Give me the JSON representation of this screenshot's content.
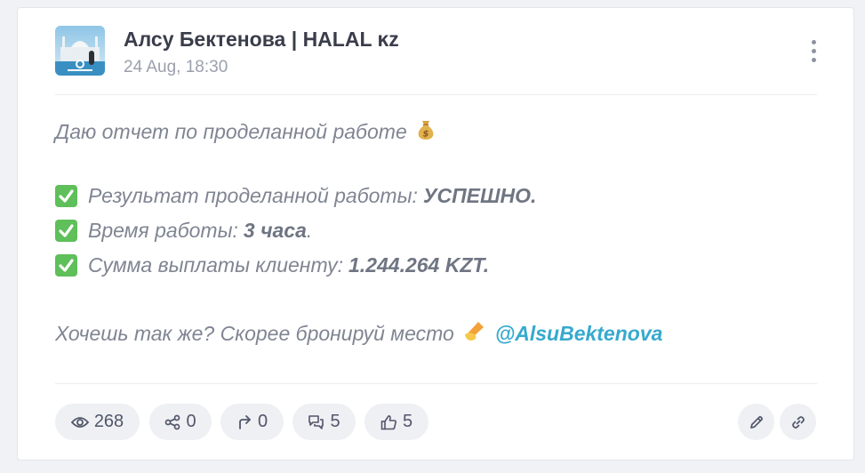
{
  "post": {
    "channel_name": "Алсу Бектенова | HALAL ĸz",
    "date": "24 Aug, 18:30",
    "intro": "Даю отчет по проделанной работе",
    "items": [
      {
        "label": "Результат проделанной работы:",
        "value": "УСПЕШНО."
      },
      {
        "label": "Время работы:",
        "value": "3 часа",
        "suffix": "."
      },
      {
        "label": "Сумма выплаты клиенту:",
        "value": "1.244.264 KZT."
      }
    ],
    "cta": "Хочешь так же? Скорее бронируй место",
    "mention": "@AlsuBektenova"
  },
  "stats": {
    "views": "268",
    "shares": "0",
    "forwards": "0",
    "comments": "5",
    "likes": "5"
  },
  "icons": [
    "more-vertical-icon",
    "money-bag-icon",
    "check-mark-icon",
    "writing-hand-icon",
    "eye-icon",
    "share-icon",
    "forward-icon",
    "comments-icon",
    "thumbs-up-icon",
    "edit-icon",
    "link-icon"
  ],
  "colors": {
    "mention": "#36a9cf",
    "check": "#5fbf5a",
    "pill_background": "#eef0f3"
  }
}
